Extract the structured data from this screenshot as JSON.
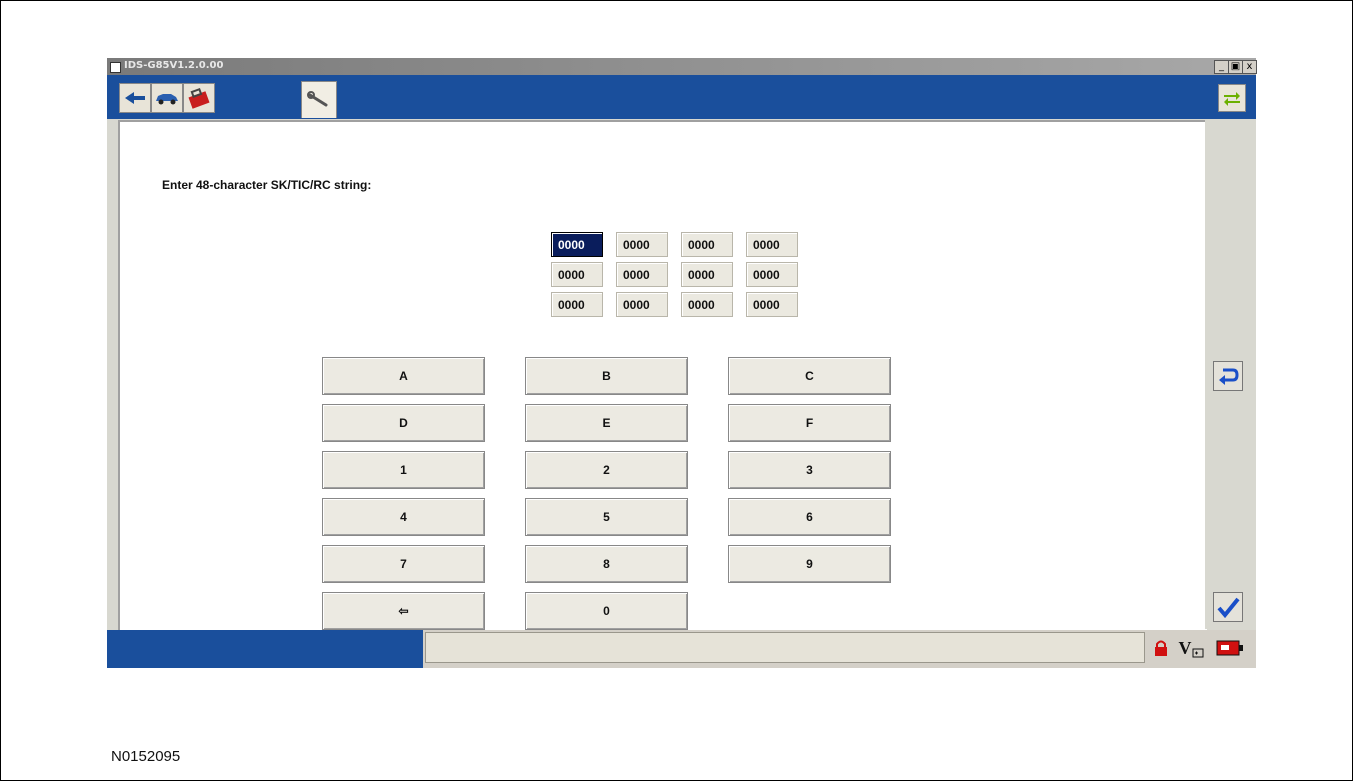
{
  "window": {
    "title": "IDS-G85V1.2.0.00",
    "controls": [
      "_",
      "&#x25A3;",
      "x"
    ]
  },
  "toolbar": {
    "tools": [
      {
        "icon": "connector-icon"
      },
      {
        "icon": "vehicle-icon"
      },
      {
        "icon": "toolbox-icon"
      }
    ],
    "active_tab_icon": "wrench-icon",
    "right_icon": "swap-arrows-icon"
  },
  "content": {
    "prompt": "Enter 48-character SK/TIC/RC string:",
    "grid": [
      [
        "0000",
        "0000",
        "0000",
        "0000"
      ],
      [
        "0000",
        "0000",
        "0000",
        "0000"
      ],
      [
        "0000",
        "0000",
        "0000",
        "0000"
      ]
    ],
    "selected_cell": [
      0,
      0
    ],
    "keypad": [
      [
        "A",
        "B",
        "C"
      ],
      [
        "D",
        "E",
        "F"
      ],
      [
        "1",
        "2",
        "3"
      ],
      [
        "4",
        "5",
        "6"
      ],
      [
        "7",
        "8",
        "9"
      ],
      [
        "⇦",
        "0"
      ]
    ]
  },
  "sidebar": {
    "back_icon": "return-icon",
    "confirm_icon": "checkmark-icon"
  },
  "statusbar": {
    "status_text": "",
    "icons": [
      "lock-icon",
      "battery-voltage-icon",
      "vci-icon"
    ],
    "vbatt_label": "V"
  },
  "caption": "N0152095",
  "colors": {
    "toolbar_blue": "#1a4f9c",
    "selected_cell": "#0a1d5c",
    "button_face": "#eceae2"
  }
}
